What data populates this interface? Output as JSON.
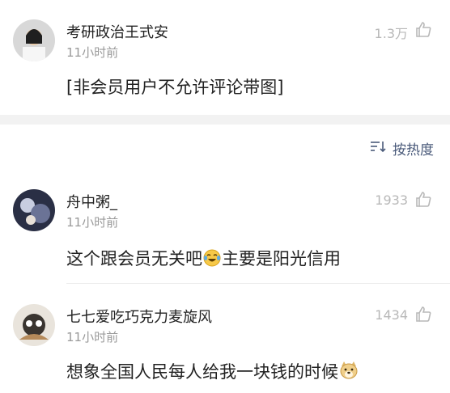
{
  "comments": [
    {
      "username": "考研政治王式安",
      "time": "11小时前",
      "likes": "1.3万",
      "content": "[非会员用户不允许评论带图]"
    },
    {
      "username": "舟中粥_",
      "time": "11小时前",
      "likes": "1933",
      "content_before": "这个跟会员无关吧",
      "content_after": "主要是阳光信用"
    },
    {
      "username": "七七爱吃巧克力麦旋风",
      "time": "11小时前",
      "likes": "1434",
      "content_before": "想象全国人民每人给我一块钱的时候"
    }
  ],
  "sort": {
    "label": "按热度",
    "icon": "sort-icon"
  },
  "icons": {
    "like": "thumbs-up-icon",
    "emoji_laugh": "laugh-cry-emoji",
    "emoji_doge": "doge-emoji"
  },
  "colors": {
    "text": "#222222",
    "meta": "#9a9a9a",
    "likes": "#b8b8b8",
    "sort": "#4a5a7a",
    "gap": "#f2f2f2"
  }
}
